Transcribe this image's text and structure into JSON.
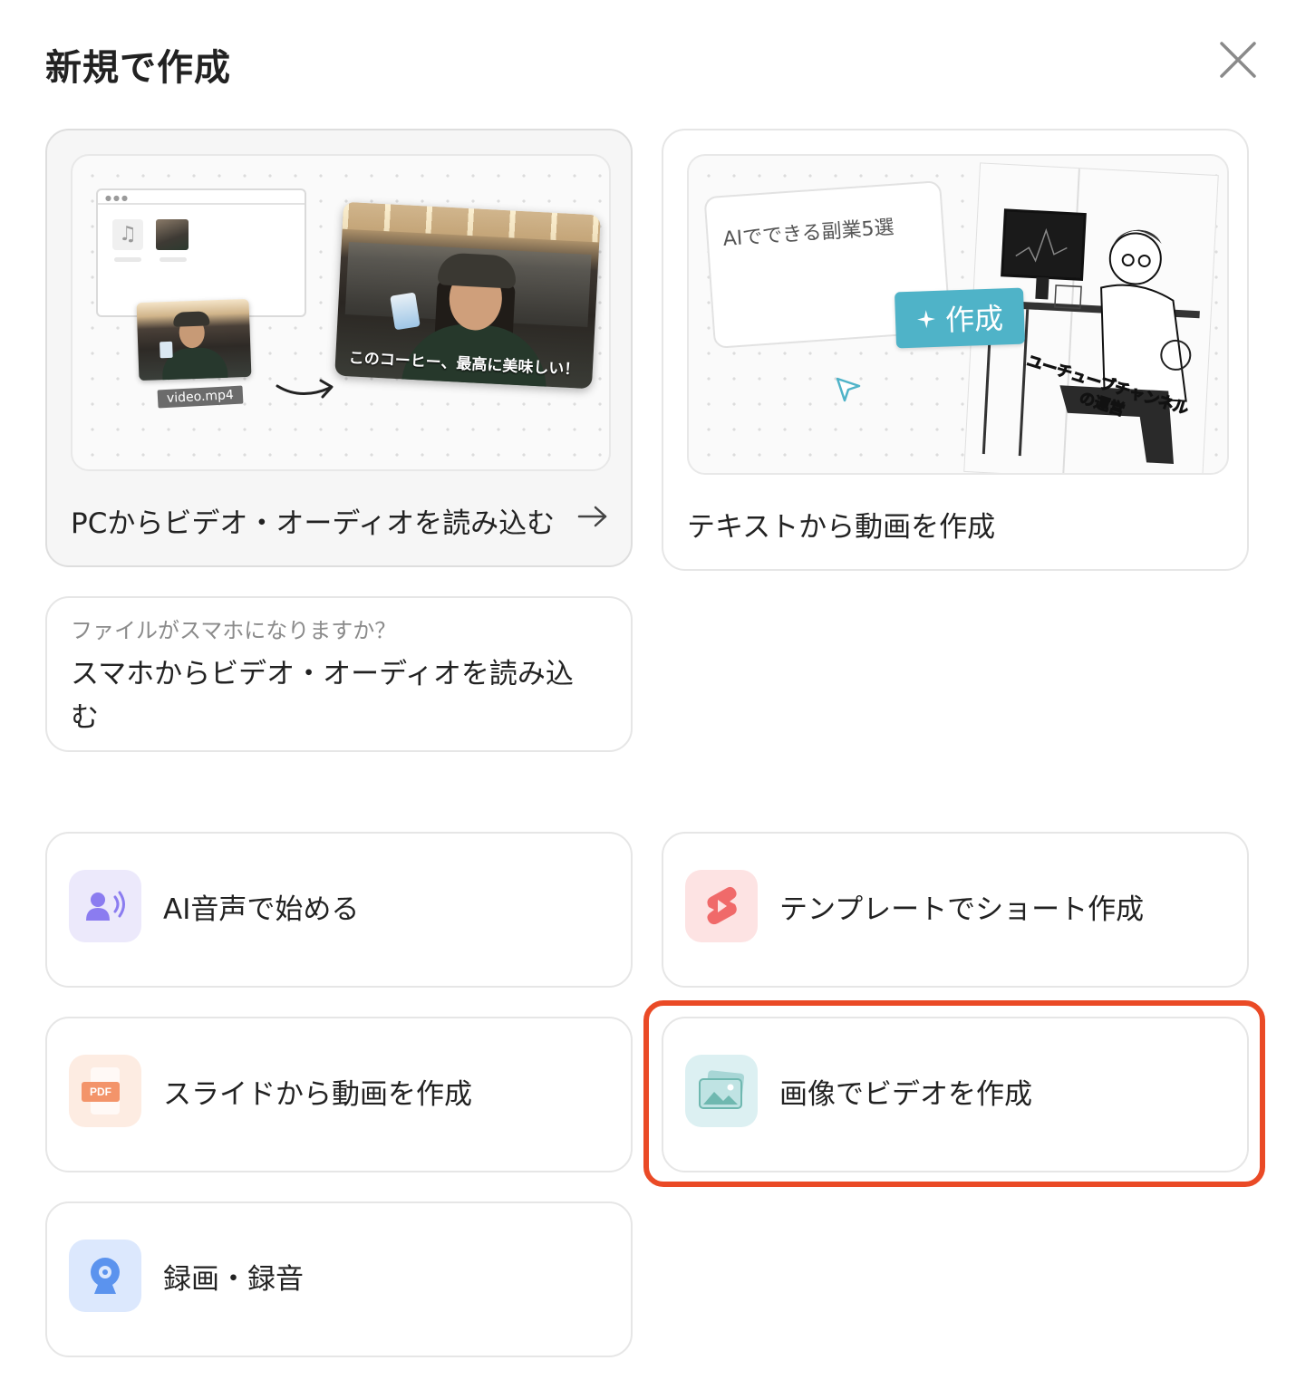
{
  "modal": {
    "title": "新規で作成",
    "close_icon": "close-icon"
  },
  "pc_import": {
    "label": "PCからビデオ・オーディオを読み込む",
    "arrow_icon": "arrow-right-icon",
    "preview": {
      "file_name": "video.mp4",
      "caption": "このコーヒー、最高に美味しい！"
    }
  },
  "text_to_video": {
    "label": "テキストから動画を作成",
    "preview": {
      "prompt_text": "AIでできる副業5選",
      "create_button": "作成",
      "sparkle_icon": "sparkle-icon",
      "image_caption_line1": "ユーチューブチャンネル",
      "image_caption_line2": "の運営"
    }
  },
  "mobile_import": {
    "hint": "ファイルがスマホになりますか？",
    "label": "スマホからビデオ・オーディオを読み込む"
  },
  "options": {
    "ai_voice": {
      "label": "AI音声で始める",
      "icon": "ai-voice-icon",
      "icon_bg": "#ece9fb",
      "icon_color": "#8b7cf0"
    },
    "short_template": {
      "label": "テンプレートでショート作成",
      "icon": "shorts-icon",
      "icon_bg": "#fde3e3",
      "icon_color": "#f06a6a"
    },
    "slides": {
      "label": "スライドから動画を作成",
      "icon": "pdf-icon",
      "icon_text": "PDF",
      "icon_bg": "#fdece2",
      "icon_color": "#f3946a"
    },
    "image_video": {
      "label": "画像でビデオを作成",
      "icon": "image-icon",
      "icon_bg": "#dcf0f2",
      "icon_color": "#6fb8b0"
    },
    "record": {
      "label": "録画・録音",
      "icon": "webcam-icon",
      "icon_bg": "#dce8fd",
      "icon_color": "#5b93ee"
    }
  },
  "highlight_color": "#ea4a26"
}
